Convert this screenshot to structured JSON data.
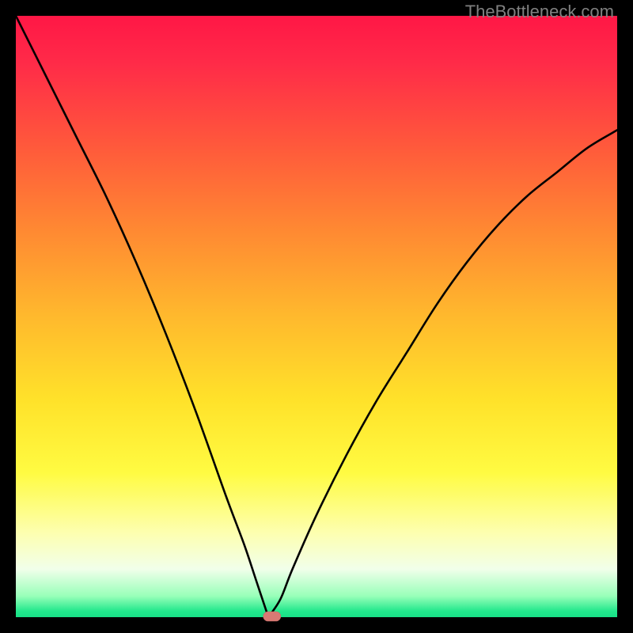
{
  "watermark": "TheBottleneck.com",
  "colors": {
    "frame": "#000000",
    "gradient_top": "#ff1746",
    "gradient_bottom": "#18e087",
    "curve": "#000000",
    "marker": "#d87a74",
    "watermark_text": "#808080"
  },
  "chart_data": {
    "type": "line",
    "title": "",
    "xlabel": "",
    "ylabel": "",
    "xlim": [
      0,
      100
    ],
    "ylim": [
      0,
      100
    ],
    "grid": false,
    "legend": false,
    "note": "Bottleneck-curve style plot. X is an unlabeled parameter (0–100 normalized across plot width). Y is an unlabeled metric (0 = bottom / green / good, 100 = top / red / bad). The curve forms a deep V with its minimum near x≈42 at y≈0, rising steeply on both sides. A small rounded marker sits at the minimum.",
    "x": [
      0,
      5,
      10,
      15,
      20,
      25,
      30,
      35,
      38,
      40,
      42,
      44,
      46,
      50,
      55,
      60,
      65,
      70,
      75,
      80,
      85,
      90,
      95,
      100
    ],
    "values": [
      100,
      90,
      80,
      70,
      59,
      47,
      34,
      20,
      12,
      6,
      0,
      3,
      8,
      17,
      27,
      36,
      44,
      52,
      59,
      65,
      70,
      74,
      78,
      81
    ],
    "marker": {
      "x": 42.6,
      "y": 0
    }
  }
}
